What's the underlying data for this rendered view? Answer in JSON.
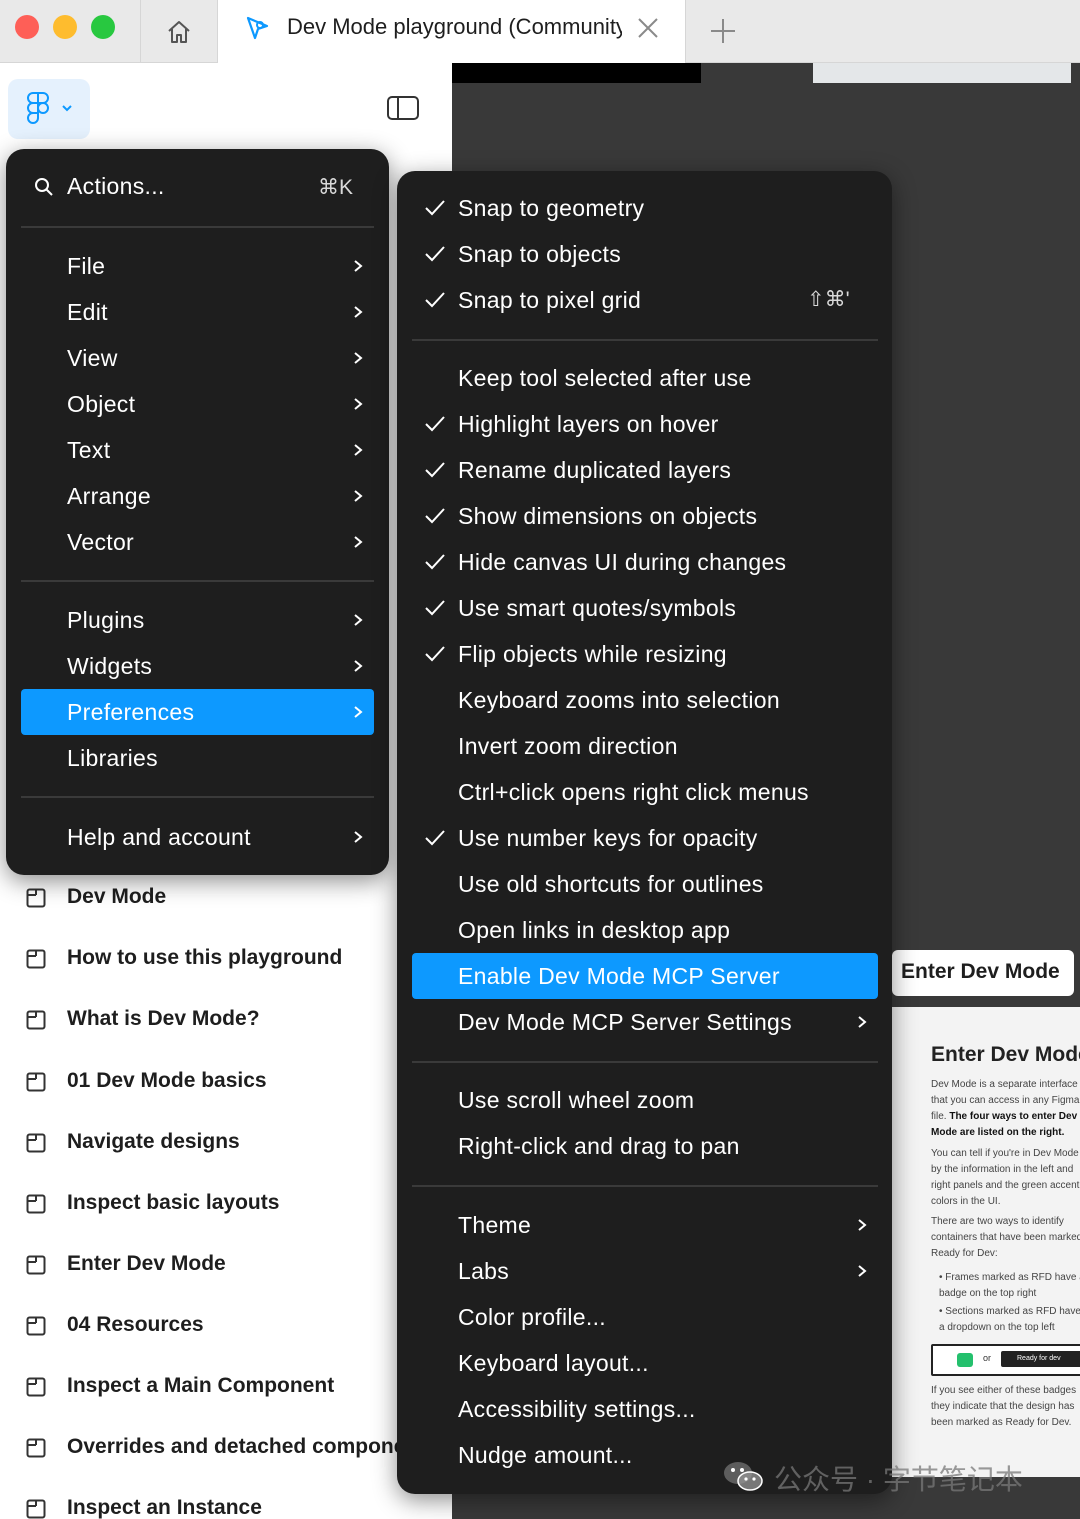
{
  "tabs": {
    "active_title": "Dev Mode playground (Community)"
  },
  "main_menu": {
    "search_label": "Actions...",
    "search_shortcut": "⌘K",
    "items": [
      {
        "label": "File"
      },
      {
        "label": "Edit"
      },
      {
        "label": "View"
      },
      {
        "label": "Object"
      },
      {
        "label": "Text"
      },
      {
        "label": "Arrange"
      },
      {
        "label": "Vector"
      },
      {
        "label": "Plugins"
      },
      {
        "label": "Widgets"
      },
      {
        "label": "Preferences"
      },
      {
        "label": "Libraries"
      },
      {
        "label": "Help and account"
      }
    ]
  },
  "preferences_menu": {
    "items": [
      {
        "label": "Snap to geometry",
        "checked": true
      },
      {
        "label": "Snap to objects",
        "checked": true
      },
      {
        "label": "Snap to pixel grid",
        "checked": true,
        "shortcut": "⇧⌘'"
      },
      {
        "label": "Keep tool selected after use",
        "checked": false
      },
      {
        "label": "Highlight layers on hover",
        "checked": true
      },
      {
        "label": "Rename duplicated layers",
        "checked": true
      },
      {
        "label": "Show dimensions on objects",
        "checked": true
      },
      {
        "label": "Hide canvas UI during changes",
        "checked": true
      },
      {
        "label": "Use smart quotes/symbols",
        "checked": true
      },
      {
        "label": "Flip objects while resizing",
        "checked": true
      },
      {
        "label": "Keyboard zooms into selection",
        "checked": false
      },
      {
        "label": "Invert zoom direction",
        "checked": false
      },
      {
        "label": "Ctrl+click opens right click menus",
        "checked": false
      },
      {
        "label": "Use number keys for opacity",
        "checked": true
      },
      {
        "label": "Use old shortcuts for outlines",
        "checked": false
      },
      {
        "label": "Open links in desktop app",
        "checked": false
      },
      {
        "label": "Enable Dev Mode MCP Server",
        "checked": false,
        "highlighted": true
      },
      {
        "label": "Dev Mode MCP Server Settings",
        "checked": false
      },
      {
        "label": "Use scroll wheel zoom",
        "checked": false
      },
      {
        "label": "Right-click and drag to pan",
        "checked": false
      },
      {
        "label": "Theme",
        "checked": false
      },
      {
        "label": "Labs",
        "checked": false
      },
      {
        "label": "Color profile...",
        "checked": false
      },
      {
        "label": "Keyboard layout...",
        "checked": false
      },
      {
        "label": "Accessibility settings...",
        "checked": false
      },
      {
        "label": "Nudge amount...",
        "checked": false
      }
    ]
  },
  "pages": [
    {
      "label": "Dev Mode"
    },
    {
      "label": "How to use this playground"
    },
    {
      "label": "What is Dev Mode?"
    },
    {
      "label": "01 Dev Mode basics"
    },
    {
      "label": "Navigate designs"
    },
    {
      "label": "Inspect basic layouts"
    },
    {
      "label": "Enter Dev Mode"
    },
    {
      "label": "04 Resources"
    },
    {
      "label": "Inspect a Main Component"
    },
    {
      "label": "Overrides and detached components"
    },
    {
      "label": "Inspect an Instance"
    }
  ],
  "canvas": {
    "chip_label": "Enter Dev Mode",
    "card_title": "Enter Dev Mode",
    "card_p1": "Dev Mode is a separate interface that you can access in any Figma file.",
    "card_p1_bold": "The four ways to enter Dev Mode are listed on the right.",
    "card_p2": "You can tell if you're in Dev Mode by the information in the left and right panels and the green accent colors in the UI.",
    "card_p3": "There are two ways to identify containers that have been marked Ready for Dev:",
    "card_li1": "Frames marked as RFD have a badge on the top right",
    "card_li2": "Sections marked as RFD have a dropdown on the top left",
    "card_or": "or",
    "card_ready": "Ready for dev",
    "card_p4": "If you see either of these badges they indicate that the design has been marked as Ready for Dev."
  },
  "watermark": {
    "text": "公众号 · 字节笔记本"
  },
  "colors": {
    "accent": "#0d99ff",
    "menu_bg": "#1e1e1e",
    "canvas_bg": "#393939"
  }
}
